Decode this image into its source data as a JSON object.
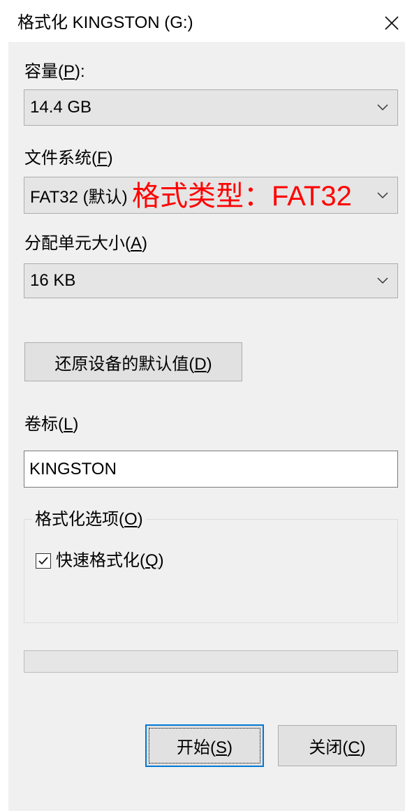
{
  "window": {
    "title": "格式化 KINGSTON (G:)"
  },
  "capacity": {
    "label": "容量(P):",
    "access_key": "P",
    "value": "14.4 GB"
  },
  "file_system": {
    "label": "文件系统(F)",
    "access_key": "F",
    "value": "FAT32 (默认)",
    "annotation": "格式类型：FAT32"
  },
  "allocation_unit": {
    "label": "分配单元大小(A)",
    "access_key": "A",
    "value": "16 KB"
  },
  "restore_defaults": {
    "label": "还原设备的默认值(D)",
    "access_key": "D"
  },
  "volume_label": {
    "label": "卷标(L)",
    "access_key": "L",
    "value": "KINGSTON"
  },
  "format_options": {
    "legend": "格式化选项(O)",
    "access_key": "O",
    "quick_format": {
      "label": "快速格式化(Q)",
      "access_key": "Q",
      "checked": true
    }
  },
  "progress": {
    "percent": 0
  },
  "buttons": {
    "start": {
      "label": "开始(S)",
      "access_key": "S",
      "focused": true
    },
    "close": {
      "label": "关闭(C)",
      "access_key": "C"
    }
  },
  "icons": {
    "window_close": "close-icon",
    "dropdown_arrow": "chevron-down-icon",
    "checkbox_mark": "checkmark-icon"
  },
  "colors": {
    "annotation": "#ff0000",
    "focus_border": "#0078d7"
  }
}
